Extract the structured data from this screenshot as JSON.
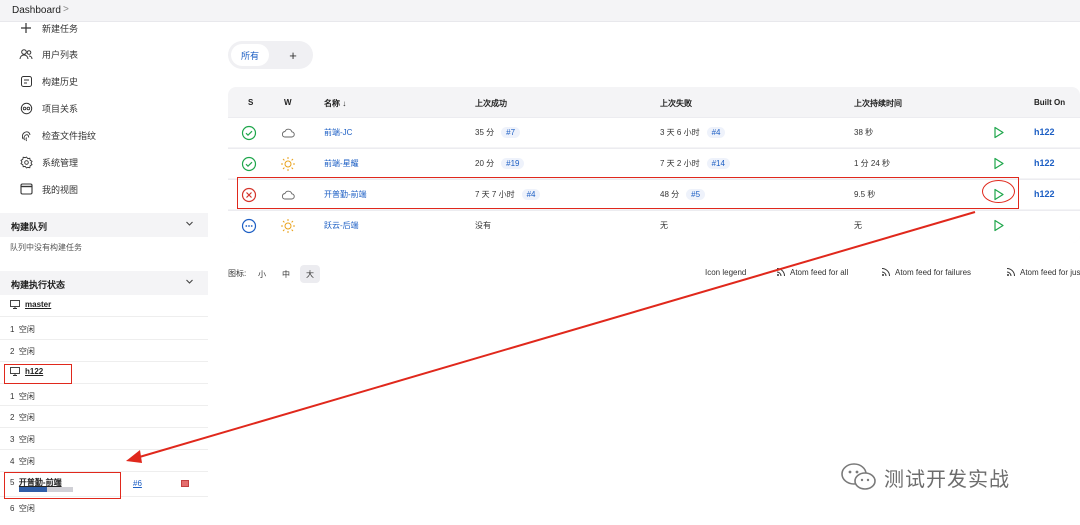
{
  "breadcrumb": {
    "root": "Dashboard"
  },
  "sidebar": {
    "tasks": [
      {
        "label": "新建任务",
        "icon": "plus-icon"
      },
      {
        "label": "用户列表",
        "icon": "users-icon"
      },
      {
        "label": "构建历史",
        "icon": "history-icon"
      },
      {
        "label": "项目关系",
        "icon": "relationship-icon"
      },
      {
        "label": "检查文件指纹",
        "icon": "fingerprint-icon"
      },
      {
        "label": "系统管理",
        "icon": "gear-icon"
      },
      {
        "label": "我的视图",
        "icon": "window-icon"
      }
    ],
    "queue": {
      "title": "构建队列",
      "empty": "队列中没有构建任务"
    },
    "executors": {
      "title": "构建执行状态",
      "master": {
        "name": "master",
        "slots": [
          {
            "num": "1",
            "state": "空闲"
          },
          {
            "num": "2",
            "state": "空闲"
          }
        ]
      },
      "h122": {
        "name": "h122",
        "slots_before": [
          {
            "num": "1",
            "state": "空闲"
          },
          {
            "num": "2",
            "state": "空闲"
          },
          {
            "num": "3",
            "state": "空闲"
          },
          {
            "num": "4",
            "state": "空闲"
          }
        ],
        "running": {
          "num": "5",
          "job": "开普勤-前端",
          "build": "#6",
          "progress": 0.52
        },
        "slots_after": [
          {
            "num": "6",
            "state": "空闲"
          }
        ]
      }
    }
  },
  "tabs": {
    "active": "所有",
    "add": "+"
  },
  "table": {
    "headers": {
      "s": "S",
      "w": "W",
      "name": "名称 ↓",
      "last_success": "上次成功",
      "last_failure": "上次失败",
      "last_duration": "上次持续时间",
      "built_on": "Built On"
    },
    "rows": [
      {
        "status": "success",
        "weather": "cloudy",
        "name": "前端-JC",
        "last_success": "35 分",
        "last_success_build": "#7",
        "last_failure": "3 天 6 小时",
        "last_failure_build": "#4",
        "duration": "38 秒",
        "built_on": "h122"
      },
      {
        "status": "success",
        "weather": "sunny",
        "name": "前端-星耀",
        "last_success": "20 分",
        "last_success_build": "#19",
        "last_failure": "7 天 2 小时",
        "last_failure_build": "#14",
        "duration": "1 分 24 秒",
        "built_on": "h122"
      },
      {
        "status": "failure",
        "weather": "cloudy",
        "name": "开普勤-前端",
        "last_success": "7 天 7 小时",
        "last_success_build": "#4",
        "last_failure": "48 分",
        "last_failure_build": "#5",
        "duration": "9.5 秒",
        "built_on": "h122"
      },
      {
        "status": "notbuilt",
        "weather": "sunny",
        "name": "跃云-后端",
        "last_success": "没有",
        "last_success_build": "",
        "last_failure": "无",
        "last_failure_build": "",
        "duration": "无",
        "built_on": ""
      }
    ]
  },
  "footer": {
    "icon_label": "图标:",
    "sizes": [
      "小",
      "中",
      "大"
    ],
    "active_size": "大",
    "icon_legend": "Icon legend",
    "feeds": [
      "Atom feed for all",
      "Atom feed for failures",
      "Atom feed for just latest builds"
    ]
  },
  "watermark": {
    "text": "测试开发实战"
  },
  "colors": {
    "accent": "#1d5fc4",
    "success": "#1ea64b",
    "failure": "#d4342b",
    "notbuilt": "#1d5fc4",
    "annotation": "#e0281c"
  }
}
